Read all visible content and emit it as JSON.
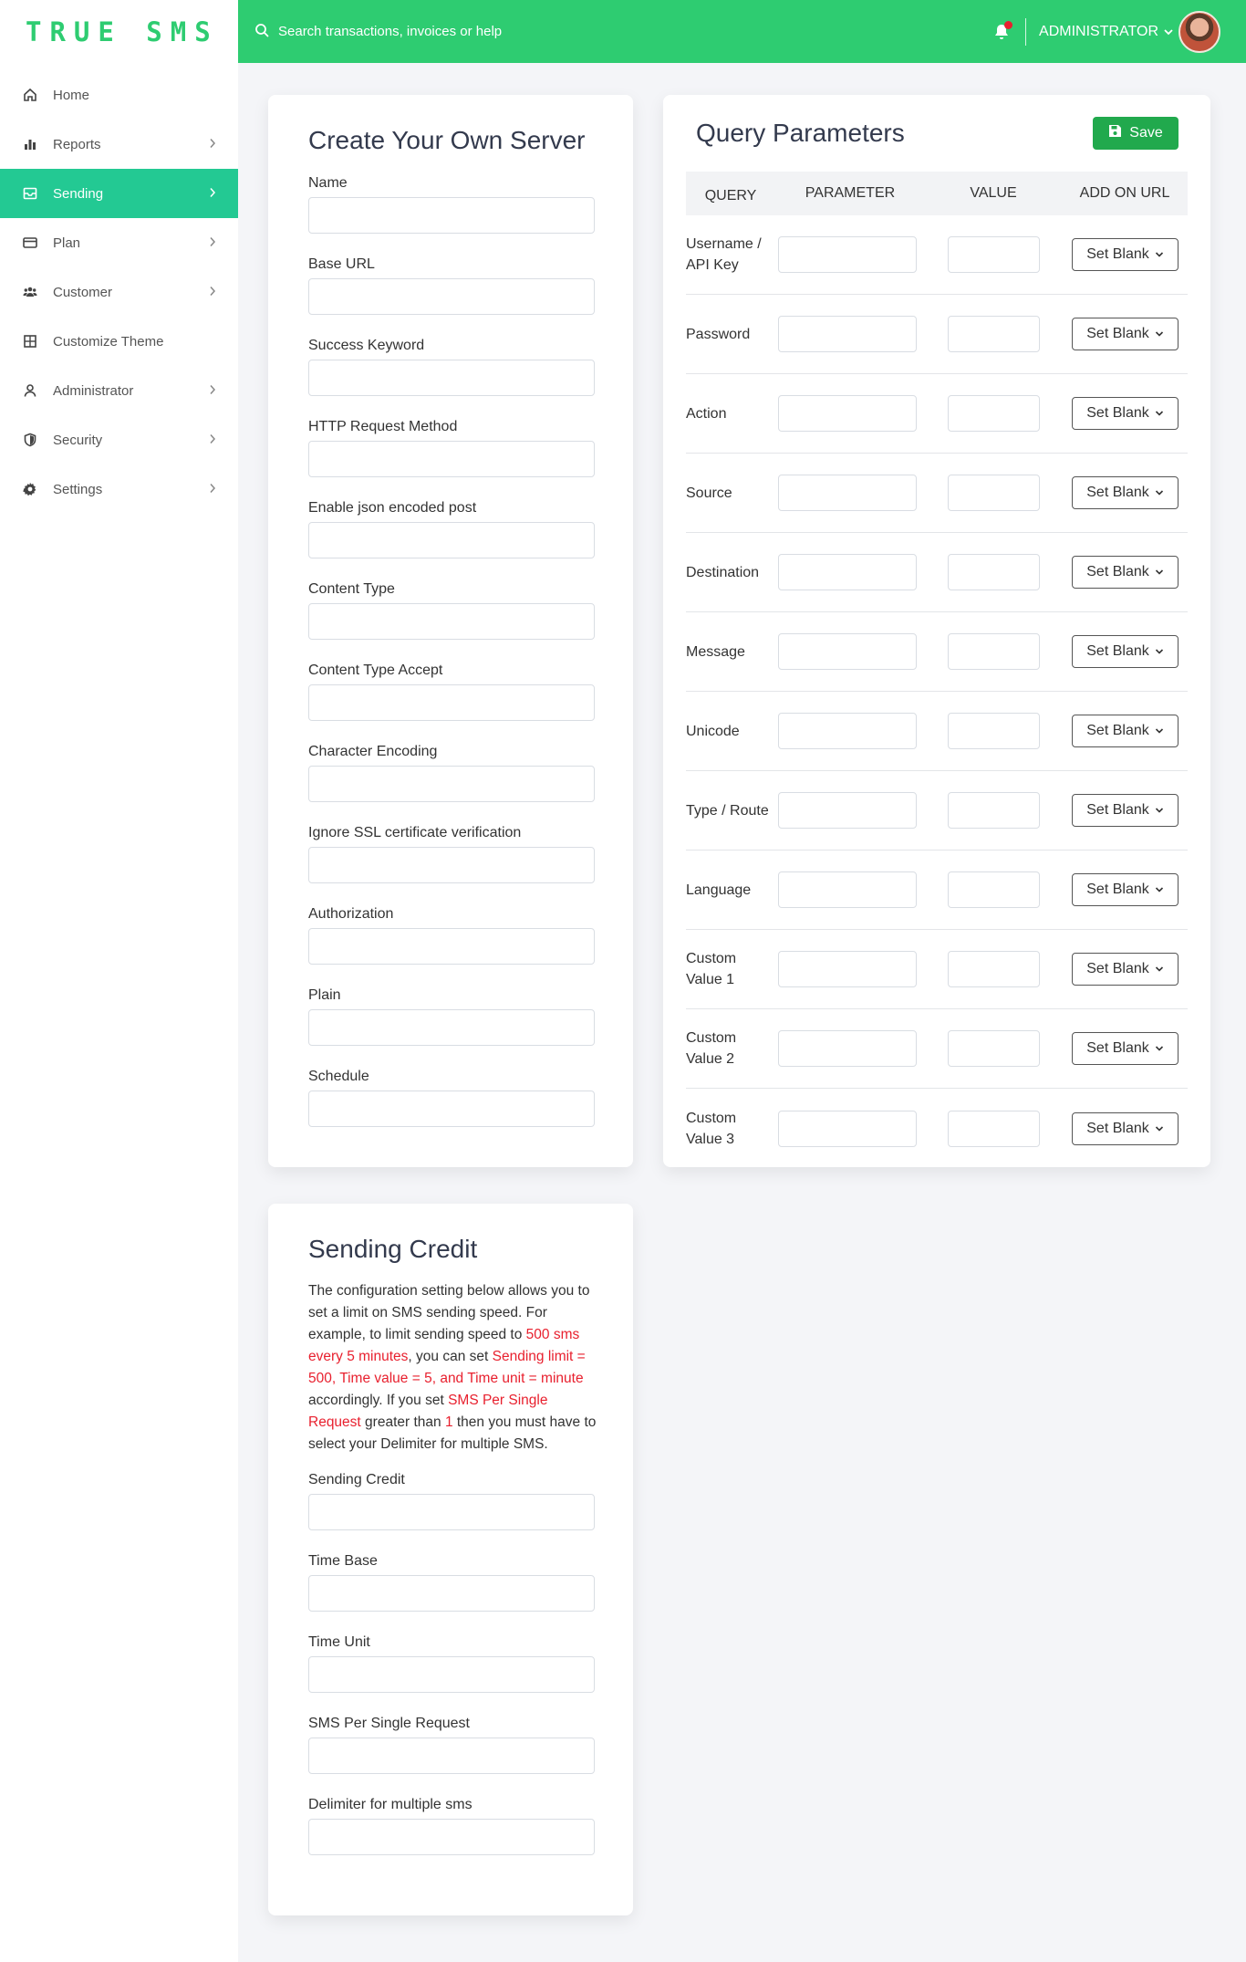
{
  "brand": {
    "logo": "TRUE SMS"
  },
  "topbar": {
    "search_placeholder": "Search transactions, invoices or help",
    "user_label": "ADMINISTRATOR"
  },
  "sidebar": {
    "items": [
      {
        "label": "Home",
        "icon": "home-icon",
        "has_chevron": false,
        "active": false
      },
      {
        "label": "Reports",
        "icon": "bar-chart-icon",
        "has_chevron": true,
        "active": false
      },
      {
        "label": "Sending",
        "icon": "mail-icon",
        "has_chevron": true,
        "active": true
      },
      {
        "label": "Plan",
        "icon": "credit-card-icon",
        "has_chevron": true,
        "active": false
      },
      {
        "label": "Customer",
        "icon": "users-icon",
        "has_chevron": true,
        "active": false
      },
      {
        "label": "Customize Theme",
        "icon": "grid-icon",
        "has_chevron": false,
        "active": false
      },
      {
        "label": "Administrator",
        "icon": "user-icon",
        "has_chevron": true,
        "active": false
      },
      {
        "label": "Security",
        "icon": "shield-icon",
        "has_chevron": true,
        "active": false
      },
      {
        "label": "Settings",
        "icon": "gear-icon",
        "has_chevron": true,
        "active": false
      }
    ]
  },
  "server": {
    "title": "Create Your Own Server",
    "fields": [
      "Name",
      "Base URL",
      "Success Keyword",
      "HTTP Request Method",
      "Enable json encoded post",
      "Content Type",
      "Content Type Accept",
      "Character Encoding",
      "Ignore SSL certificate verification",
      "Authorization",
      "Plain",
      "Schedule"
    ]
  },
  "query": {
    "title": "Query Parameters",
    "save_label": "Save",
    "headers": {
      "query": "QUERY",
      "parameter": "PARAMETER",
      "value": "VALUE",
      "add_on_url": "ADD ON URL"
    },
    "rows": [
      "Username / API Key",
      "Password",
      "Action",
      "Source",
      "Destination",
      "Message",
      "Unicode",
      "Type / Route",
      "Language",
      "Custom Value 1",
      "Custom Value 2",
      "Custom Value 3"
    ],
    "set_blank_label": "Set Blank"
  },
  "credit": {
    "title": "Sending Credit",
    "description": [
      {
        "t": "The configuration setting below allows you to set a limit on SMS sending speed. For example, to limit sending speed to ",
        "hl": false
      },
      {
        "t": "500 sms every 5 minutes",
        "hl": true
      },
      {
        "t": ", you can set ",
        "hl": false
      },
      {
        "t": "Sending limit = 500, Time value = 5, and Time unit = minute",
        "hl": true
      },
      {
        "t": " accordingly. If you set ",
        "hl": false
      },
      {
        "t": "SMS Per Single Request",
        "hl": true
      },
      {
        "t": " greater than ",
        "hl": false
      },
      {
        "t": "1",
        "hl": true
      },
      {
        "t": " then you must have to select your Delimiter for multiple SMS.",
        "hl": false
      }
    ],
    "fields": [
      "Sending Credit",
      "Time Base",
      "Time Unit",
      "SMS Per Single Request",
      "Delimiter for multiple sms"
    ]
  },
  "colors": {
    "brand_green": "#2ecc71",
    "active_teal": "#23c993",
    "save_green": "#21a94d",
    "highlight_red": "#e8202e"
  }
}
